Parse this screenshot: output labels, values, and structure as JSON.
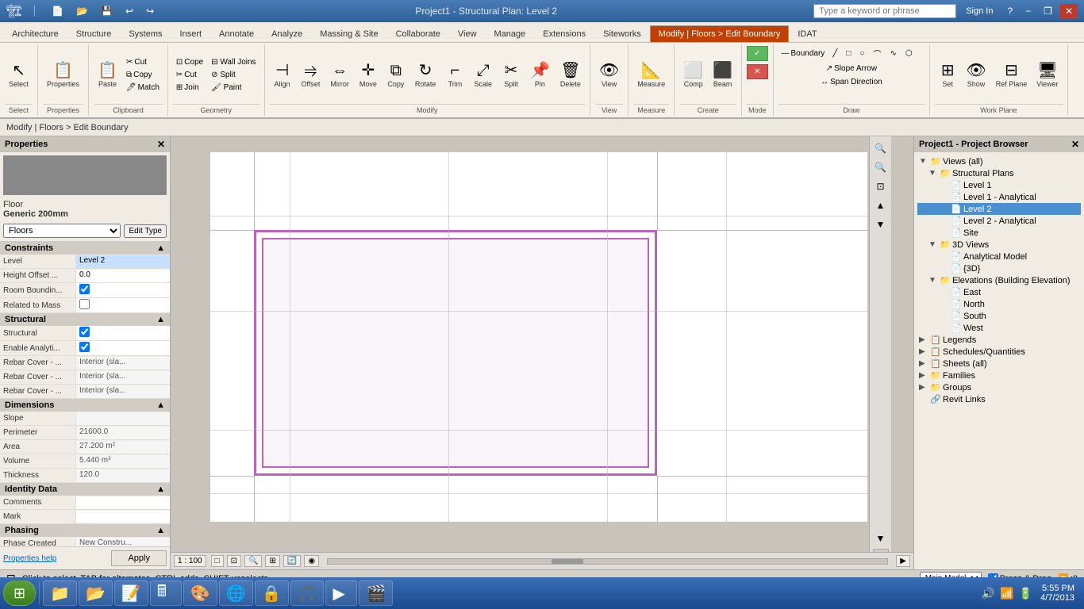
{
  "titlebar": {
    "title": "Project1 - Structural Plan: Level 2",
    "search_placeholder": "Type a keyword or phrase",
    "sign_in": "Sign In",
    "min_label": "−",
    "max_label": "□",
    "close_label": "✕",
    "restore_label": "❐"
  },
  "ribbon_tabs": [
    {
      "label": "Architecture",
      "active": false
    },
    {
      "label": "Structure",
      "active": false
    },
    {
      "label": "Systems",
      "active": false
    },
    {
      "label": "Insert",
      "active": false
    },
    {
      "label": "Annotate",
      "active": false
    },
    {
      "label": "Analyze",
      "active": false
    },
    {
      "label": "Massing & Site",
      "active": false
    },
    {
      "label": "Collaborate",
      "active": false
    },
    {
      "label": "View",
      "active": false
    },
    {
      "label": "Manage",
      "active": false
    },
    {
      "label": "Extensions",
      "active": false
    },
    {
      "label": "Siteworks",
      "active": false
    },
    {
      "label": "Modify | Floors > Edit Boundary",
      "active": true
    },
    {
      "label": "IDAT",
      "active": false
    }
  ],
  "ribbon_groups": {
    "select_label": "Select",
    "properties_label": "Properties",
    "clipboard_label": "Clipboard",
    "geometry_label": "Geometry",
    "modify_label": "Modify",
    "view_label": "View",
    "measure_label": "Measure",
    "create_label": "Create",
    "mode_label": "Mode",
    "draw_label": "Draw",
    "work_plane_label": "Work Plane",
    "cope_label": "Cope",
    "boundary_label": "Boundary",
    "slope_arrow_label": "Slope Arrow",
    "span_direction_label": "Span Direction",
    "finish_green_label": "✓",
    "cancel_red_label": "✕",
    "set_label": "Set",
    "show_label": "Show",
    "ref_plane_label": "Ref Plane",
    "viewer_label": "Viewer"
  },
  "breadcrumb": "Modify | Floors > Edit Boundary",
  "properties": {
    "title": "Properties",
    "floor_type": "Floor",
    "floor_name": "Generic 200mm",
    "selector_value": "Floors",
    "edit_type_label": "Edit Type",
    "sections": {
      "constraints": {
        "label": "Constraints",
        "fields": [
          {
            "label": "Level",
            "value": "Level 2",
            "editable": true
          },
          {
            "label": "Height Offset ...",
            "value": "0.0",
            "editable": true
          },
          {
            "label": "Room Boundin...",
            "value": "",
            "type": "checkbox",
            "checked": true
          },
          {
            "label": "Related to Mass",
            "value": "",
            "type": "checkbox",
            "checked": false
          }
        ]
      },
      "structural": {
        "label": "Structural",
        "fields": [
          {
            "label": "Structural",
            "value": "",
            "type": "checkbox",
            "checked": true
          },
          {
            "label": "Enable Analyti...",
            "value": "",
            "type": "checkbox",
            "checked": true
          },
          {
            "label": "Rebar Cover - ...",
            "value": "Interior (sla...",
            "editable": false
          },
          {
            "label": "Rebar Cover - ...",
            "value": "Interior (sla...",
            "editable": false
          },
          {
            "label": "Rebar Cover - ...",
            "value": "Interior (sla...",
            "editable": false
          }
        ]
      },
      "dimensions": {
        "label": "Dimensions",
        "fields": [
          {
            "label": "Slope",
            "value": "",
            "editable": false
          },
          {
            "label": "Perimeter",
            "value": "21600.0",
            "editable": false
          },
          {
            "label": "Area",
            "value": "27.200 m²",
            "editable": false
          },
          {
            "label": "Volume",
            "value": "5.440 m³",
            "editable": false
          },
          {
            "label": "Thickness",
            "value": "120.0",
            "editable": false
          }
        ]
      },
      "identity": {
        "label": "Identity Data",
        "fields": [
          {
            "label": "Comments",
            "value": "",
            "editable": true
          },
          {
            "label": "Mark",
            "value": "",
            "editable": true
          }
        ]
      },
      "phasing": {
        "label": "Phasing",
        "fields": [
          {
            "label": "Phase Created",
            "value": "New Constru...",
            "editable": false
          }
        ]
      }
    },
    "help_link": "Properties help",
    "apply_button": "Apply"
  },
  "canvas": {
    "scale": "1 : 100"
  },
  "project_browser": {
    "title": "Project1 - Project Browser",
    "tree": [
      {
        "label": "Views (all)",
        "level": 0,
        "expanded": true,
        "icon": "📁"
      },
      {
        "label": "Structural Plans",
        "level": 1,
        "expanded": true,
        "icon": "📁"
      },
      {
        "label": "Level 1",
        "level": 2,
        "expanded": false,
        "icon": "📄"
      },
      {
        "label": "Level 1 - Analytical",
        "level": 2,
        "expanded": false,
        "icon": "📄"
      },
      {
        "label": "Level 2",
        "level": 2,
        "expanded": false,
        "icon": "📄",
        "selected": true
      },
      {
        "label": "Level 2 - Analytical",
        "level": 2,
        "expanded": false,
        "icon": "📄"
      },
      {
        "label": "Site",
        "level": 2,
        "expanded": false,
        "icon": "📄"
      },
      {
        "label": "3D Views",
        "level": 1,
        "expanded": true,
        "icon": "📁"
      },
      {
        "label": "Analytical Model",
        "level": 2,
        "expanded": false,
        "icon": "📄"
      },
      {
        "label": "{3D}",
        "level": 2,
        "expanded": false,
        "icon": "📄"
      },
      {
        "label": "Elevations (Building Elevation)",
        "level": 1,
        "expanded": true,
        "icon": "📁"
      },
      {
        "label": "East",
        "level": 2,
        "expanded": false,
        "icon": "📄"
      },
      {
        "label": "North",
        "level": 2,
        "expanded": false,
        "icon": "📄"
      },
      {
        "label": "South",
        "level": 2,
        "expanded": false,
        "icon": "📄"
      },
      {
        "label": "West",
        "level": 2,
        "expanded": false,
        "icon": "📄"
      },
      {
        "label": "Legends",
        "level": 0,
        "expanded": false,
        "icon": "📋"
      },
      {
        "label": "Schedules/Quantities",
        "level": 0,
        "expanded": false,
        "icon": "📋"
      },
      {
        "label": "Sheets (all)",
        "level": 0,
        "expanded": false,
        "icon": "📋"
      },
      {
        "label": "Families",
        "level": 0,
        "expanded": false,
        "icon": "📁"
      },
      {
        "label": "Groups",
        "level": 0,
        "expanded": false,
        "icon": "📁"
      },
      {
        "label": "Revit Links",
        "level": 0,
        "expanded": false,
        "icon": "🔗"
      }
    ]
  },
  "statusbar": {
    "message": "Click to select, TAB for alternates, CTRL adds, SHIFT unselects.",
    "model": "Main Model",
    "press_drag": "Press & Drag",
    "filter_count": ":0"
  },
  "taskbar": {
    "items": [
      {
        "label": "Start",
        "icon": "⊞"
      },
      {
        "label": "",
        "icon": "📁"
      },
      {
        "label": "",
        "icon": "📂"
      },
      {
        "label": "",
        "icon": "📝"
      },
      {
        "label": "",
        "icon": "🖩"
      },
      {
        "label": "",
        "icon": "🖼"
      },
      {
        "label": "",
        "icon": "🌐"
      },
      {
        "label": "",
        "icon": "🔒"
      },
      {
        "label": "",
        "icon": "⚙"
      },
      {
        "label": "",
        "icon": "🎵"
      },
      {
        "label": "",
        "icon": "▶"
      },
      {
        "label": "",
        "icon": "🎬"
      }
    ],
    "clock_time": "5:55 PM",
    "clock_date": "4/7/2013"
  }
}
